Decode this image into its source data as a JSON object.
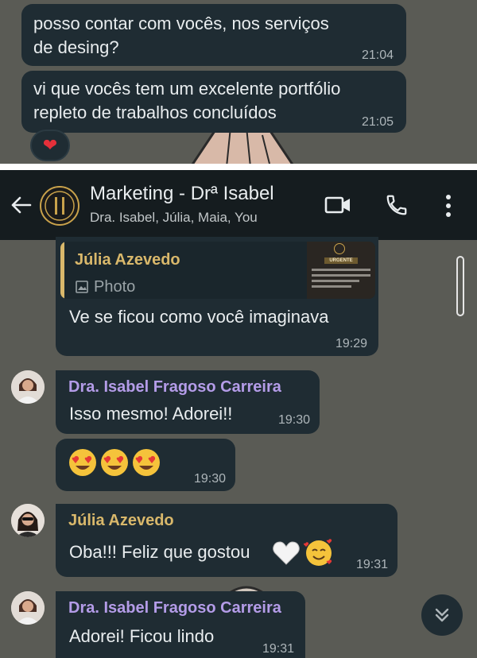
{
  "top_chat": {
    "messages": [
      {
        "text": "posso contar com vocês, nos serviços\nde desing?",
        "time": "21:04"
      },
      {
        "text": "vi que vocês tem um excelente portfólio\nrepleto de trabalhos concluídos",
        "time": "21:05"
      }
    ],
    "reaction": "❤"
  },
  "header": {
    "title": "Marketing - Drª Isabel",
    "subtitle": "Dra. Isabel, Júlia, Maia, You"
  },
  "chat": {
    "reply_message": {
      "quote_sender": "Júlia Azevedo",
      "quote_type": "Photo",
      "thumbnail_badge": "URGENTE",
      "text": "Ve se ficou como você imaginava",
      "time": "19:29"
    },
    "msg1": {
      "sender": "Dra. Isabel Fragoso Carreira",
      "text": "Isso mesmo! Adorei!!",
      "time": "19:30"
    },
    "msg2": {
      "time": "19:30"
    },
    "msg3": {
      "sender": "Júlia Azevedo",
      "text": "Oba!!! Feliz que gostou",
      "time": "19:31"
    },
    "msg4": {
      "sender": "Dra. Isabel Fragoso Carreira",
      "text": "Adorei! Ficou lindo",
      "time": "19:31"
    }
  },
  "colors": {
    "bubble": "#1f2c33",
    "header": "#151c1f",
    "sender_isabel": "#b49ce8",
    "sender_julia": "#d9b86b",
    "quote_bar": "#d9b86b"
  }
}
